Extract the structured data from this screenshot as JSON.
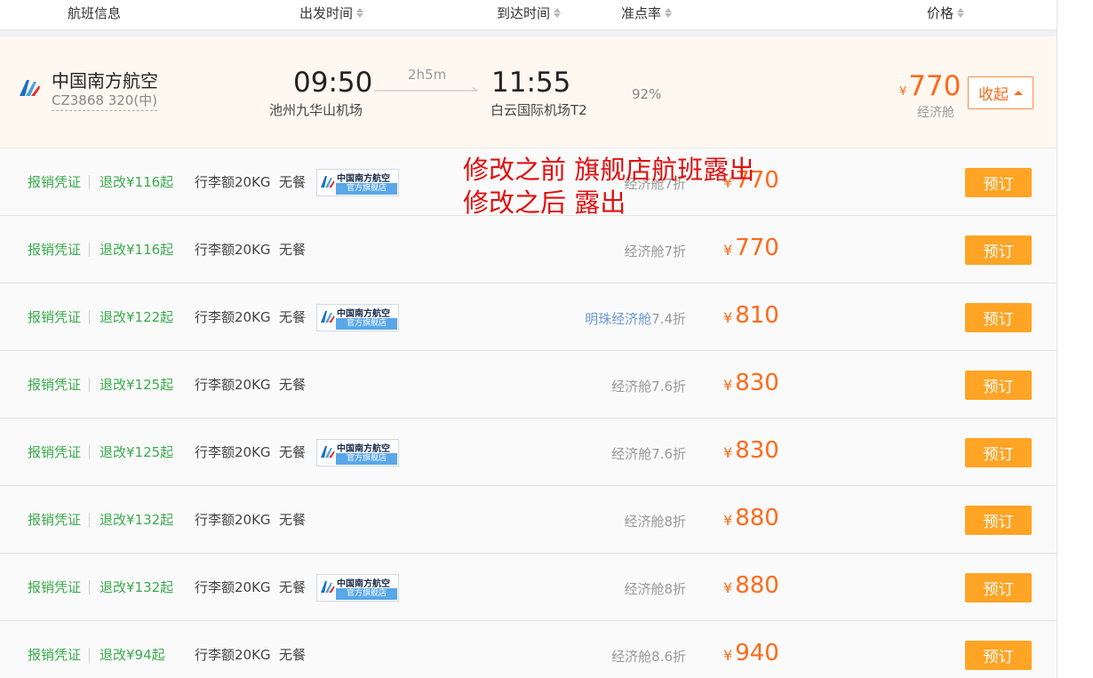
{
  "header": {
    "col_flight": "航班信息",
    "col_depart": "出发时间",
    "col_arrive": "到达时间",
    "col_ontime": "准点率",
    "col_price": "价格"
  },
  "flight": {
    "airline": "中国南方航空",
    "flight_no": "CZ3868 320(中)",
    "dep_time": "09:50",
    "dep_airport": "池州九华山机场",
    "duration": "2h5m",
    "arr_time": "11:55",
    "arr_airport": "白云国际机场T2",
    "ontime_rate": "92%",
    "currency": "¥",
    "price": "770",
    "cabin": "经济舱",
    "collapse_label": "收起"
  },
  "badge": {
    "name": "中国南方航空",
    "tag": "官方旗舰店"
  },
  "fares": [
    {
      "receipt": "报销凭证",
      "refund": "退改¥116起",
      "baggage": "行李额20KG",
      "meal": "无餐",
      "flagship": true,
      "cabin": "经济舱7折",
      "price": "770",
      "book": "预订"
    },
    {
      "receipt": "报销凭证",
      "refund": "退改¥116起",
      "baggage": "行李额20KG",
      "meal": "无餐",
      "flagship": false,
      "cabin": "经济舱7折",
      "price": "770",
      "book": "预订"
    },
    {
      "receipt": "报销凭证",
      "refund": "退改¥122起",
      "baggage": "行李额20KG",
      "meal": "无餐",
      "flagship": true,
      "cabin_name": "明珠经济舱",
      "cabin_discount": "7.4折",
      "cabin": "明珠经济舱7.4折",
      "price": "810",
      "book": "预订"
    },
    {
      "receipt": "报销凭证",
      "refund": "退改¥125起",
      "baggage": "行李额20KG",
      "meal": "无餐",
      "flagship": false,
      "cabin": "经济舱7.6折",
      "price": "830",
      "book": "预订"
    },
    {
      "receipt": "报销凭证",
      "refund": "退改¥125起",
      "baggage": "行李额20KG",
      "meal": "无餐",
      "flagship": true,
      "cabin": "经济舱7.6折",
      "price": "830",
      "book": "预订"
    },
    {
      "receipt": "报销凭证",
      "refund": "退改¥132起",
      "baggage": "行李额20KG",
      "meal": "无餐",
      "flagship": false,
      "cabin": "经济舱8折",
      "price": "880",
      "book": "预订"
    },
    {
      "receipt": "报销凭证",
      "refund": "退改¥132起",
      "baggage": "行李额20KG",
      "meal": "无餐",
      "flagship": true,
      "cabin": "经济舱8折",
      "price": "880",
      "book": "预订"
    },
    {
      "receipt": "报销凭证",
      "refund": "退改¥94起",
      "baggage": "行李额20KG",
      "meal": "无餐",
      "flagship": false,
      "cabin": "经济舱8.6折",
      "price": "940",
      "book": "预订"
    }
  ],
  "annotation": {
    "line1": "修改之前 旗舰店航班露出",
    "line2": "修改之后 露出"
  },
  "colors": {
    "accent_orange": "#ff6a1a",
    "book_button": "#ffa425",
    "green_text": "#3aab4c",
    "annotation_red": "#e01010",
    "flight_bg": "#fef8f1"
  }
}
